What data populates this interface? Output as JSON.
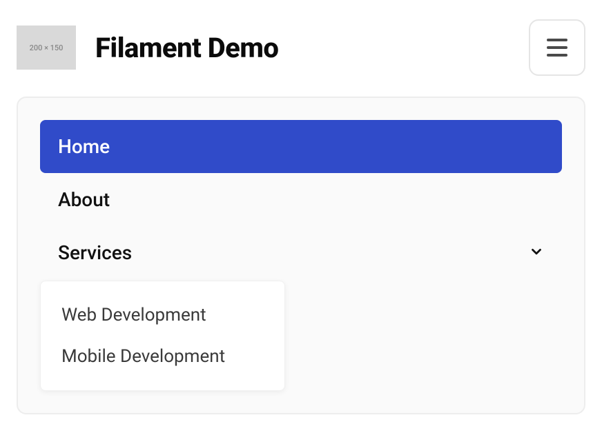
{
  "header": {
    "logo_placeholder": "200 × 150",
    "title": "Filament Demo"
  },
  "nav": {
    "items": [
      {
        "label": "Home",
        "active": true,
        "has_children": false
      },
      {
        "label": "About",
        "active": false,
        "has_children": false
      },
      {
        "label": "Services",
        "active": false,
        "has_children": true
      }
    ],
    "services_children": [
      {
        "label": "Web Development"
      },
      {
        "label": "Mobile Development"
      }
    ]
  },
  "colors": {
    "active_bg": "#304bc9"
  }
}
